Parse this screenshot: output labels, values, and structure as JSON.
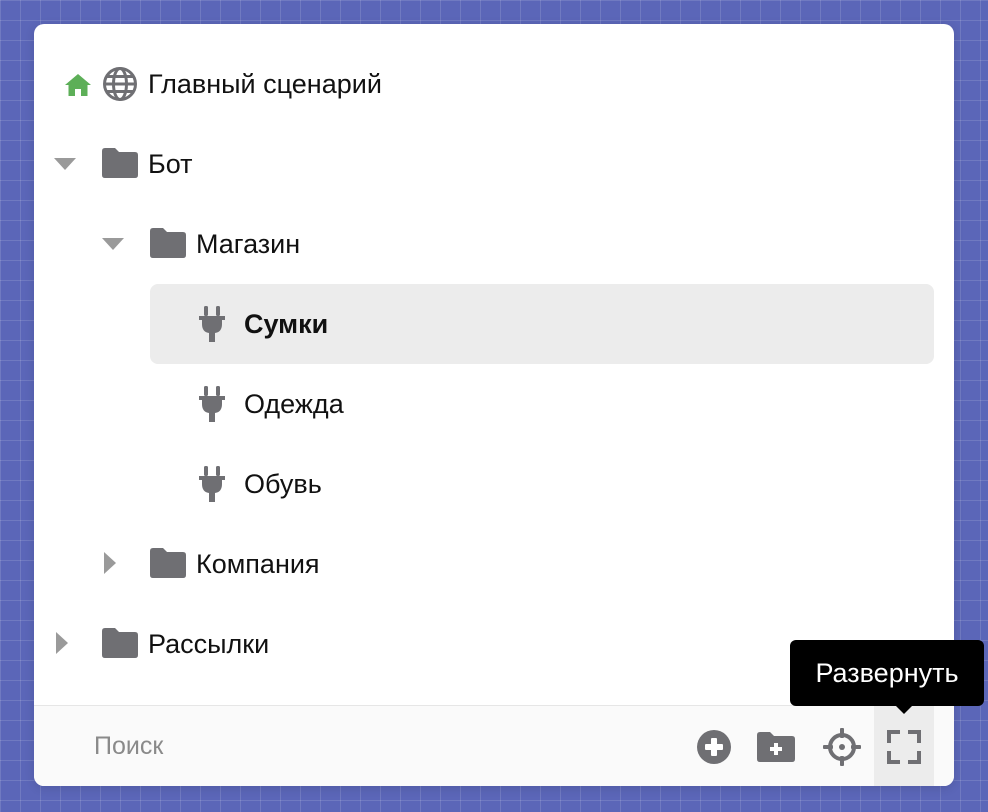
{
  "tree": {
    "root": {
      "label": "Главный сценарий",
      "icon": "globe-icon",
      "home_icon": "home-icon",
      "home_color": "#5daf58"
    },
    "bot": {
      "label": "Бот",
      "expanded": true
    },
    "shop": {
      "label": "Магазин",
      "expanded": true
    },
    "bags": {
      "label": "Сумки",
      "selected": true,
      "icon": "plug-icon"
    },
    "clothes": {
      "label": "Одежда",
      "icon": "plug-icon"
    },
    "shoes": {
      "label": "Обувь",
      "icon": "plug-icon"
    },
    "company": {
      "label": "Компания",
      "expanded": false
    },
    "mailings": {
      "label": "Рассылки",
      "expanded": false
    }
  },
  "footer": {
    "search_placeholder": "Поиск",
    "search_value": "",
    "buttons": [
      "add-circle-icon",
      "add-folder-icon",
      "crosshair-icon",
      "expand-icon"
    ]
  },
  "tooltip": {
    "text": "Развернуть"
  },
  "colors": {
    "icon_gray": "#6f6f73",
    "caret_gray": "#9a9a9a",
    "selected_bg": "#ececec",
    "accent_green": "#5daf58"
  }
}
